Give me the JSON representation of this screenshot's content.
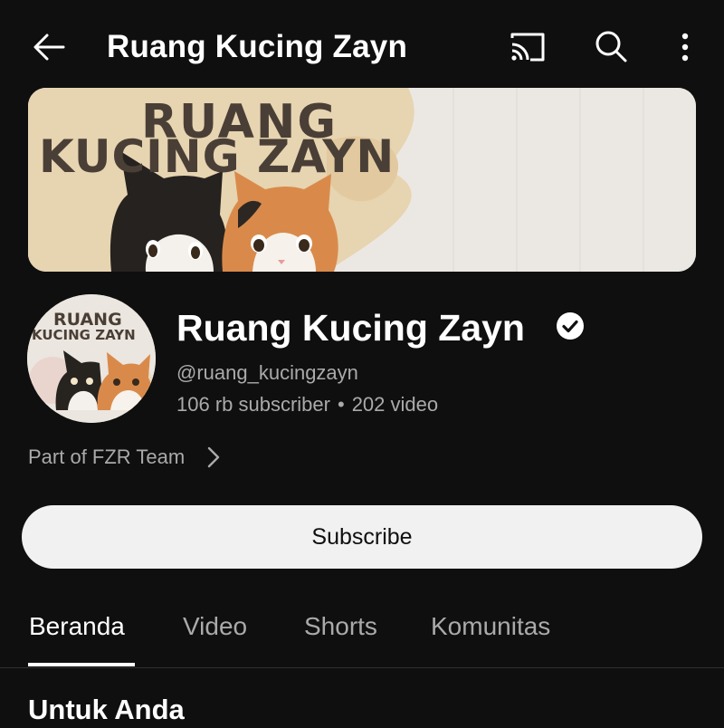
{
  "header": {
    "title": "Ruang Kucing Zayn",
    "icons": [
      "back-arrow-icon",
      "cast-icon",
      "search-icon",
      "more-vert-icon"
    ]
  },
  "banner": {
    "line1": "RUANG",
    "line2": "KUCING ZAYN"
  },
  "avatar": {
    "line1": "RUANG",
    "line2": "KUCING ZAYN"
  },
  "channel": {
    "name": "Ruang Kucing Zayn",
    "verified": true,
    "handle": "@ruang_kucingzayn",
    "subscribers": "106 rb subscriber",
    "separator": "•",
    "videos": "202 video"
  },
  "team_link": {
    "label": "Part of FZR Team"
  },
  "subscribe": {
    "label": "Subscribe"
  },
  "tabs": [
    {
      "label": "Beranda",
      "active": true
    },
    {
      "label": "Video",
      "active": false
    },
    {
      "label": "Shorts",
      "active": false
    },
    {
      "label": "Komunitas",
      "active": false
    }
  ],
  "section": {
    "title": "Untuk Anda"
  },
  "colors": {
    "background": "#0f0f0f",
    "primary_text": "#ffffff",
    "secondary_text": "#aaaaaa",
    "subscribe_bg": "#f1f1f1",
    "banner_text": "#4a3f36"
  }
}
